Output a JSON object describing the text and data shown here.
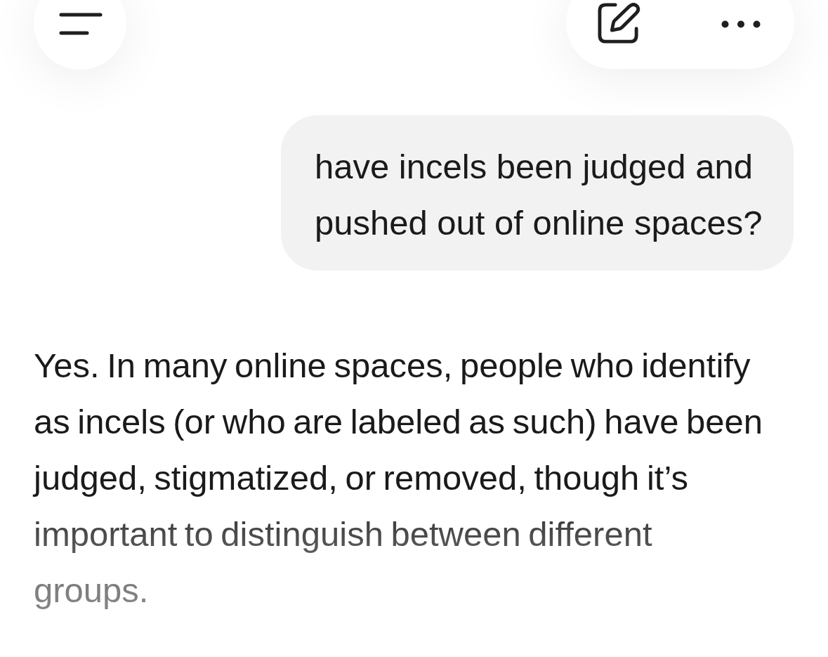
{
  "user_message": {
    "text": "have incels been judged and pushed out of online spaces?"
  },
  "assistant_message": {
    "text": "Yes. In many online spaces, people who identify as incels (or who are labeled as such) have been judged, stigmatized, or removed, though it’s important to distinguish between different groups."
  }
}
